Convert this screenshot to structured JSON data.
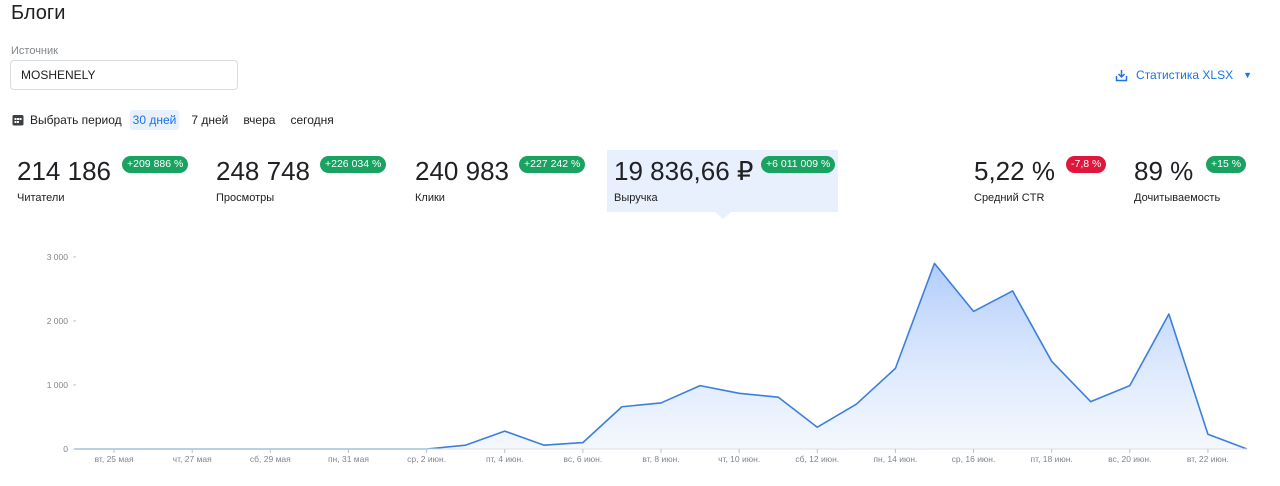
{
  "page": {
    "title": "Блоги"
  },
  "source": {
    "label": "Источник",
    "value": "MOSHENELY"
  },
  "export": {
    "label": "Статистика XLSX",
    "icon": "download-icon"
  },
  "periods": {
    "picker_label": "Выбрать период",
    "options": [
      "30 дней",
      "7 дней",
      "вчера",
      "сегодня"
    ],
    "active": "30 дней"
  },
  "metrics": [
    {
      "value": "214 186",
      "label": "Читатели",
      "badge": "+209 886 %",
      "trend": "up"
    },
    {
      "value": "248 748",
      "label": "Просмотры",
      "badge": "+226 034 %",
      "trend": "up"
    },
    {
      "value": "240 983",
      "label": "Клики",
      "badge": "+227 242 %",
      "trend": "up"
    },
    {
      "value": "19 836,66 ₽",
      "label": "Выручка",
      "badge": "+6 011 009 %",
      "trend": "up",
      "selected": true
    },
    {
      "value": "5,22 %",
      "label": "Средний CTR",
      "badge": "-7,8 %",
      "trend": "down"
    },
    {
      "value": "89 %",
      "label": "Дочитываемость",
      "badge": "+15 %",
      "trend": "up"
    }
  ],
  "colors": {
    "accent": "#1a73e8",
    "up": "#1aa260",
    "down": "#e0173c",
    "line": "#3c7fde"
  },
  "chart_data": {
    "type": "area",
    "ylim": [
      0,
      3000
    ],
    "yticks": [
      "0",
      "1 000",
      "2 000",
      "3 000"
    ],
    "ytick_values": [
      0,
      1000,
      2000,
      3000
    ],
    "x": [
      "24 мая",
      "25 мая",
      "26 мая",
      "27 мая",
      "28 мая",
      "29 мая",
      "30 мая",
      "31 мая",
      "1 июн.",
      "2 июн.",
      "3 июн.",
      "4 июн.",
      "5 июн.",
      "6 июн.",
      "7 июн.",
      "8 июн.",
      "9 июн.",
      "10 июн.",
      "11 июн.",
      "12 июн.",
      "13 июн.",
      "14 июн.",
      "15 июн.",
      "16 июн.",
      "17 июн.",
      "18 июн.",
      "19 июн.",
      "20 июн.",
      "21 июн.",
      "22 июн.",
      "23 июн."
    ],
    "xtick_labels": [
      "вт, 25 мая",
      "чт, 27 мая",
      "сб, 29 мая",
      "пн, 31 мая",
      "ср, 2 июн.",
      "пт, 4 июн.",
      "вс, 6 июн.",
      "вт, 8 июн.",
      "чт, 10 июн.",
      "сб, 12 июн.",
      "пн, 14 июн.",
      "ср, 16 июн.",
      "пт, 18 июн.",
      "вс, 20 июн.",
      "вт, 22 июн."
    ],
    "xtick_index": [
      1,
      3,
      5,
      7,
      9,
      11,
      13,
      15,
      17,
      19,
      21,
      23,
      25,
      27,
      29
    ],
    "values": [
      0,
      0,
      0,
      0,
      0,
      0,
      0,
      0,
      0,
      0,
      60,
      280,
      60,
      100,
      660,
      720,
      990,
      870,
      810,
      340,
      700,
      1260,
      2900,
      2150,
      2470,
      1370,
      740,
      990,
      2110,
      230,
      0
    ]
  }
}
